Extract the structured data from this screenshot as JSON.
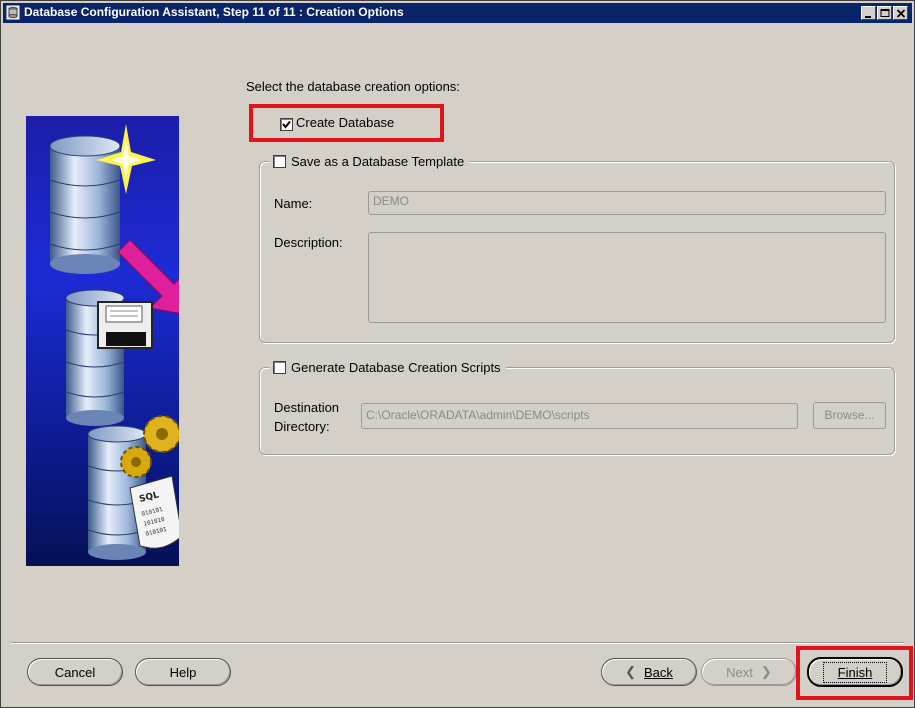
{
  "window": {
    "title": "Database Configuration Assistant, Step 11 of 11 : Creation Options",
    "controls": [
      "minimize-icon",
      "maximize-icon",
      "close-icon"
    ]
  },
  "main": {
    "prompt": "Select the database creation options:",
    "create_database": {
      "label": "Create Database",
      "checked": true
    },
    "template_group": {
      "label": "Save as a Database Template",
      "checked": false,
      "name_label": "Name:",
      "name_value": "DEMO",
      "description_label": "Description:",
      "description_value": ""
    },
    "scripts_group": {
      "label": "Generate Database Creation Scripts",
      "checked": false,
      "dest_label_line1": "Destination",
      "dest_label_line2": "Directory:",
      "dest_value": "C:\\Oracle\\ORADATA\\admin\\DEMO\\scripts",
      "browse_label": "Browse..."
    }
  },
  "footer": {
    "cancel_label": "Cancel",
    "help_label": "Help",
    "back_label": "Back",
    "next_label": "Next",
    "finish_label": "Finish"
  },
  "colors": {
    "titlebar": "#0a246a",
    "highlight": "#e3131d",
    "window_bg": "#d4d0c8"
  },
  "graphic": {
    "icons": [
      "database-star-icon",
      "arrow-icon",
      "database-save-icon",
      "floppy-disk-icon",
      "database-gears-icon",
      "sql-script-icon"
    ]
  }
}
